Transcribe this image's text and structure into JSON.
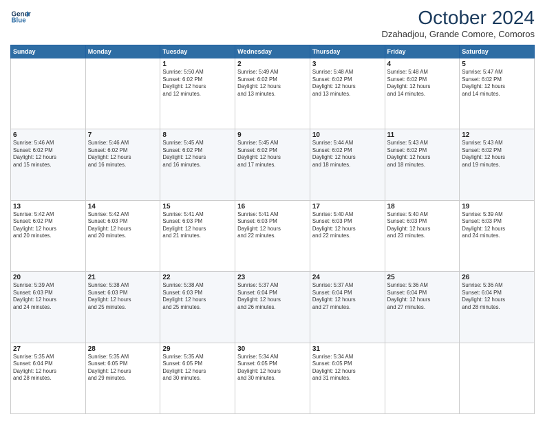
{
  "header": {
    "logo_line1": "General",
    "logo_line2": "Blue",
    "month_title": "October 2024",
    "location": "Dzahadjou, Grande Comore, Comoros"
  },
  "days_of_week": [
    "Sunday",
    "Monday",
    "Tuesday",
    "Wednesday",
    "Thursday",
    "Friday",
    "Saturday"
  ],
  "weeks": [
    [
      {
        "day": "",
        "info": ""
      },
      {
        "day": "",
        "info": ""
      },
      {
        "day": "1",
        "info": "Sunrise: 5:50 AM\nSunset: 6:02 PM\nDaylight: 12 hours\nand 12 minutes."
      },
      {
        "day": "2",
        "info": "Sunrise: 5:49 AM\nSunset: 6:02 PM\nDaylight: 12 hours\nand 13 minutes."
      },
      {
        "day": "3",
        "info": "Sunrise: 5:48 AM\nSunset: 6:02 PM\nDaylight: 12 hours\nand 13 minutes."
      },
      {
        "day": "4",
        "info": "Sunrise: 5:48 AM\nSunset: 6:02 PM\nDaylight: 12 hours\nand 14 minutes."
      },
      {
        "day": "5",
        "info": "Sunrise: 5:47 AM\nSunset: 6:02 PM\nDaylight: 12 hours\nand 14 minutes."
      }
    ],
    [
      {
        "day": "6",
        "info": "Sunrise: 5:46 AM\nSunset: 6:02 PM\nDaylight: 12 hours\nand 15 minutes."
      },
      {
        "day": "7",
        "info": "Sunrise: 5:46 AM\nSunset: 6:02 PM\nDaylight: 12 hours\nand 16 minutes."
      },
      {
        "day": "8",
        "info": "Sunrise: 5:45 AM\nSunset: 6:02 PM\nDaylight: 12 hours\nand 16 minutes."
      },
      {
        "day": "9",
        "info": "Sunrise: 5:45 AM\nSunset: 6:02 PM\nDaylight: 12 hours\nand 17 minutes."
      },
      {
        "day": "10",
        "info": "Sunrise: 5:44 AM\nSunset: 6:02 PM\nDaylight: 12 hours\nand 18 minutes."
      },
      {
        "day": "11",
        "info": "Sunrise: 5:43 AM\nSunset: 6:02 PM\nDaylight: 12 hours\nand 18 minutes."
      },
      {
        "day": "12",
        "info": "Sunrise: 5:43 AM\nSunset: 6:02 PM\nDaylight: 12 hours\nand 19 minutes."
      }
    ],
    [
      {
        "day": "13",
        "info": "Sunrise: 5:42 AM\nSunset: 6:02 PM\nDaylight: 12 hours\nand 20 minutes."
      },
      {
        "day": "14",
        "info": "Sunrise: 5:42 AM\nSunset: 6:03 PM\nDaylight: 12 hours\nand 20 minutes."
      },
      {
        "day": "15",
        "info": "Sunrise: 5:41 AM\nSunset: 6:03 PM\nDaylight: 12 hours\nand 21 minutes."
      },
      {
        "day": "16",
        "info": "Sunrise: 5:41 AM\nSunset: 6:03 PM\nDaylight: 12 hours\nand 22 minutes."
      },
      {
        "day": "17",
        "info": "Sunrise: 5:40 AM\nSunset: 6:03 PM\nDaylight: 12 hours\nand 22 minutes."
      },
      {
        "day": "18",
        "info": "Sunrise: 5:40 AM\nSunset: 6:03 PM\nDaylight: 12 hours\nand 23 minutes."
      },
      {
        "day": "19",
        "info": "Sunrise: 5:39 AM\nSunset: 6:03 PM\nDaylight: 12 hours\nand 24 minutes."
      }
    ],
    [
      {
        "day": "20",
        "info": "Sunrise: 5:39 AM\nSunset: 6:03 PM\nDaylight: 12 hours\nand 24 minutes."
      },
      {
        "day": "21",
        "info": "Sunrise: 5:38 AM\nSunset: 6:03 PM\nDaylight: 12 hours\nand 25 minutes."
      },
      {
        "day": "22",
        "info": "Sunrise: 5:38 AM\nSunset: 6:03 PM\nDaylight: 12 hours\nand 25 minutes."
      },
      {
        "day": "23",
        "info": "Sunrise: 5:37 AM\nSunset: 6:04 PM\nDaylight: 12 hours\nand 26 minutes."
      },
      {
        "day": "24",
        "info": "Sunrise: 5:37 AM\nSunset: 6:04 PM\nDaylight: 12 hours\nand 27 minutes."
      },
      {
        "day": "25",
        "info": "Sunrise: 5:36 AM\nSunset: 6:04 PM\nDaylight: 12 hours\nand 27 minutes."
      },
      {
        "day": "26",
        "info": "Sunrise: 5:36 AM\nSunset: 6:04 PM\nDaylight: 12 hours\nand 28 minutes."
      }
    ],
    [
      {
        "day": "27",
        "info": "Sunrise: 5:35 AM\nSunset: 6:04 PM\nDaylight: 12 hours\nand 28 minutes."
      },
      {
        "day": "28",
        "info": "Sunrise: 5:35 AM\nSunset: 6:05 PM\nDaylight: 12 hours\nand 29 minutes."
      },
      {
        "day": "29",
        "info": "Sunrise: 5:35 AM\nSunset: 6:05 PM\nDaylight: 12 hours\nand 30 minutes."
      },
      {
        "day": "30",
        "info": "Sunrise: 5:34 AM\nSunset: 6:05 PM\nDaylight: 12 hours\nand 30 minutes."
      },
      {
        "day": "31",
        "info": "Sunrise: 5:34 AM\nSunset: 6:05 PM\nDaylight: 12 hours\nand 31 minutes."
      },
      {
        "day": "",
        "info": ""
      },
      {
        "day": "",
        "info": ""
      }
    ]
  ]
}
